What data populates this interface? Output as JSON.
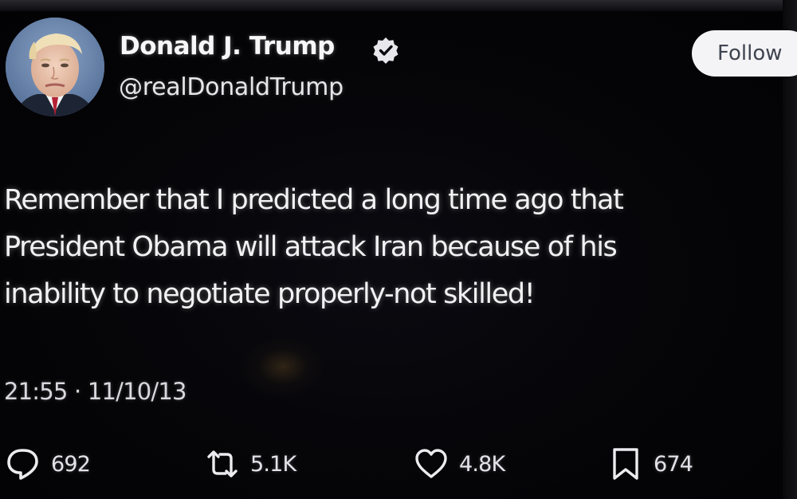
{
  "author": {
    "display_name": "Donald J. Trump",
    "handle": "@realDonaldTrump",
    "verified": true,
    "verified_color": "#1d9bf0"
  },
  "follow_button": {
    "label": "Follow"
  },
  "tweet": {
    "text": "Remember that I predicted a long time ago that\nPresident Obama will attack Iran because of his\ninability to negotiate properly-not skilled!",
    "timestamp": "21:55 · 11/10/13"
  },
  "actions": {
    "replies": {
      "icon": "reply-icon",
      "count": "692"
    },
    "reposts": {
      "icon": "repost-icon",
      "count": "5.1K"
    },
    "likes": {
      "icon": "heart-icon",
      "count": "4.8K"
    },
    "bookmarks": {
      "icon": "bookmark-icon",
      "count": "674"
    }
  },
  "theme": {
    "background": "#030306",
    "text": "#f2f2f4",
    "button_background": "#f4f4f6"
  }
}
